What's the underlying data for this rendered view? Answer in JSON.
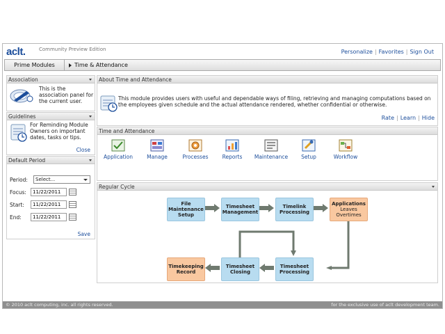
{
  "header": {
    "logo": "aclt.",
    "edition": "Community Preview Edition",
    "links": [
      "Personalize",
      "Favorites",
      "Sign Out"
    ]
  },
  "tabs": {
    "modules": "Prime Modules",
    "current": "Time & Attendance"
  },
  "association": {
    "title": "Association",
    "text": "This is the association panel for the current user."
  },
  "guidelines": {
    "title": "Guidelines",
    "text": "For Reminding Module Owners on important dates, tasks or tips.",
    "close": "Close"
  },
  "default_period": {
    "title": "Default Period",
    "period_label": "Period:",
    "period_value": "Select...",
    "focus_label": "Focus:",
    "focus_value": "11/22/2011",
    "start_label": "Start:",
    "start_value": "11/22/2011",
    "end_label": "End:",
    "end_value": "11/22/2011",
    "save": "Save"
  },
  "about": {
    "title": "About Time and Attendance",
    "text": "This module provides users with useful and dependable ways of filing, retrieving and managing computations based on the employees given schedule and the actual attendance rendered, whether confidential or otherwise.",
    "links": [
      "Rate",
      "Learn",
      "Hide"
    ]
  },
  "time_attendance": {
    "title": "Time and Attendance",
    "modules": [
      {
        "label": "Application",
        "icon": "application-icon"
      },
      {
        "label": "Manage",
        "icon": "manage-icon"
      },
      {
        "label": "Processes",
        "icon": "processes-icon"
      },
      {
        "label": "Reports",
        "icon": "reports-icon"
      },
      {
        "label": "Maintenance",
        "icon": "maintenance-icon"
      },
      {
        "label": "Setup",
        "icon": "setup-icon"
      },
      {
        "label": "Workflow",
        "icon": "workflow-icon"
      }
    ]
  },
  "regular_cycle": {
    "title": "Regular Cycle",
    "nodes": {
      "file_maintenance": [
        "File",
        "Maintenance",
        "Setup"
      ],
      "timesheet_management": [
        "Timesheet",
        "Management"
      ],
      "timelink_processing": [
        "Timelink",
        "Processing"
      ],
      "applications": {
        "title": "Applications",
        "lines": [
          "Leaves",
          "Overtimes"
        ]
      },
      "timesheet_processing": [
        "Timesheet",
        "Processing"
      ],
      "timesheet_closing": [
        "Timesheet",
        "Closing"
      ],
      "timekeeping_record": [
        "Timekeeping",
        "Record"
      ]
    }
  },
  "footer": {
    "left": "© 2010 aclt computing, inc. all rights reserved.",
    "right": "for the exclusive use of aclt development team."
  },
  "colors": {
    "brand": "#1b4d9b",
    "node_blue": "#b8dcf0",
    "node_orange": "#f9c8a0",
    "arrow": "#6f7a6f",
    "footer": "#8f8f8f"
  }
}
